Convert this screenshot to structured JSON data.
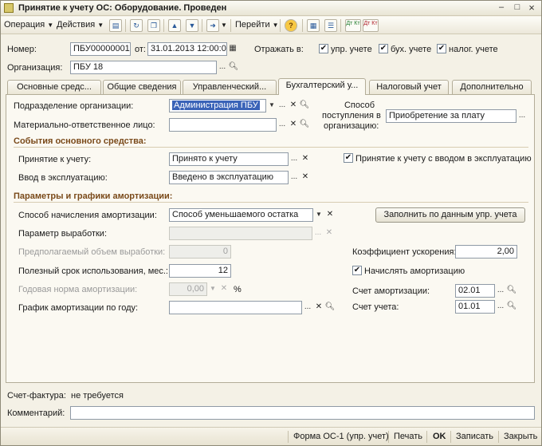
{
  "window": {
    "title": "Принятие к учету ОС: Оборудование. Проведен",
    "minimize": "–",
    "maximize": "□",
    "close": "×"
  },
  "toolbar": {
    "operation": "Операция",
    "actions": "Действия",
    "goto": "Перейти",
    "help": "?",
    "dt_kt_1": "Дт Кт",
    "dt_kt_2": "Дт Кт"
  },
  "header": {
    "number_label": "Номер:",
    "number_value": "ПБУ00000001",
    "from_label": "от:",
    "date_value": "31.01.2013 12:00:00",
    "reflect_label": "Отражать в:",
    "reflect_mgmt": "упр. учете",
    "reflect_acc": "бух. учете",
    "reflect_tax": "налог. учете",
    "org_label": "Организация:",
    "org_value": "ПБУ 18"
  },
  "tabs": [
    {
      "label": "Основные средс..."
    },
    {
      "label": "Общие сведения"
    },
    {
      "label": "Управленческий..."
    },
    {
      "label": "Бухгалтерский у..."
    },
    {
      "label": "Налоговый учет"
    },
    {
      "label": "Дополнительно"
    }
  ],
  "form": {
    "dept_label": "Подразделение организации:",
    "dept_value": "Администрация ПБУ",
    "mol_label": "Материально-ответственное лицо:",
    "mol_value": "",
    "receipt_label_1": "Способ",
    "receipt_label_2": "поступления в",
    "receipt_label_3": "организацию:",
    "receipt_value": "Приобретение за плату",
    "events_title": "События основного средства:",
    "accept_label": "Принятие к учету:",
    "accept_value": "Принято к учету",
    "commission_label": "Ввод в эксплуатацию:",
    "commission_value": "Введено в эксплуатацию",
    "accept_with_commission": "Принятие к учету с вводом в эксплуатацию",
    "amort_title": "Параметры и графики амортизации:",
    "method_label": "Способ начисления амортизации:",
    "method_value": "Способ уменьшаемого остатка",
    "fill_button": "Заполнить по данным упр. учета",
    "output_param_label": "Параметр выработки:",
    "output_param_value": "",
    "expected_output_label": "Предполагаемый объем выработки:",
    "expected_output_value": "0",
    "useful_life_label": "Полезный срок использования, мес.:",
    "useful_life_value": "12",
    "annual_rate_label": "Годовая норма амортизации:",
    "annual_rate_value": "0,00",
    "percent": "%",
    "schedule_label": "График амортизации по году:",
    "schedule_value": "",
    "accel_label": "Коэффициент ускорения:",
    "accel_value": "2,00",
    "accrue_amort": "Начислять амортизацию",
    "amort_account_label": "Счет амортизации:",
    "amort_account_value": "02.01",
    "account_label": "Счет учета:",
    "account_value": "01.01"
  },
  "bottom": {
    "invoice_label": "Счет-фактура:",
    "invoice_value": "не требуется",
    "comment_label": "Комментарий:",
    "comment_value": ""
  },
  "footer": {
    "form_os1": "Форма ОС-1 (упр. учет)",
    "print": "Печать",
    "ok": "OK",
    "save": "Записать",
    "close": "Закрыть"
  }
}
